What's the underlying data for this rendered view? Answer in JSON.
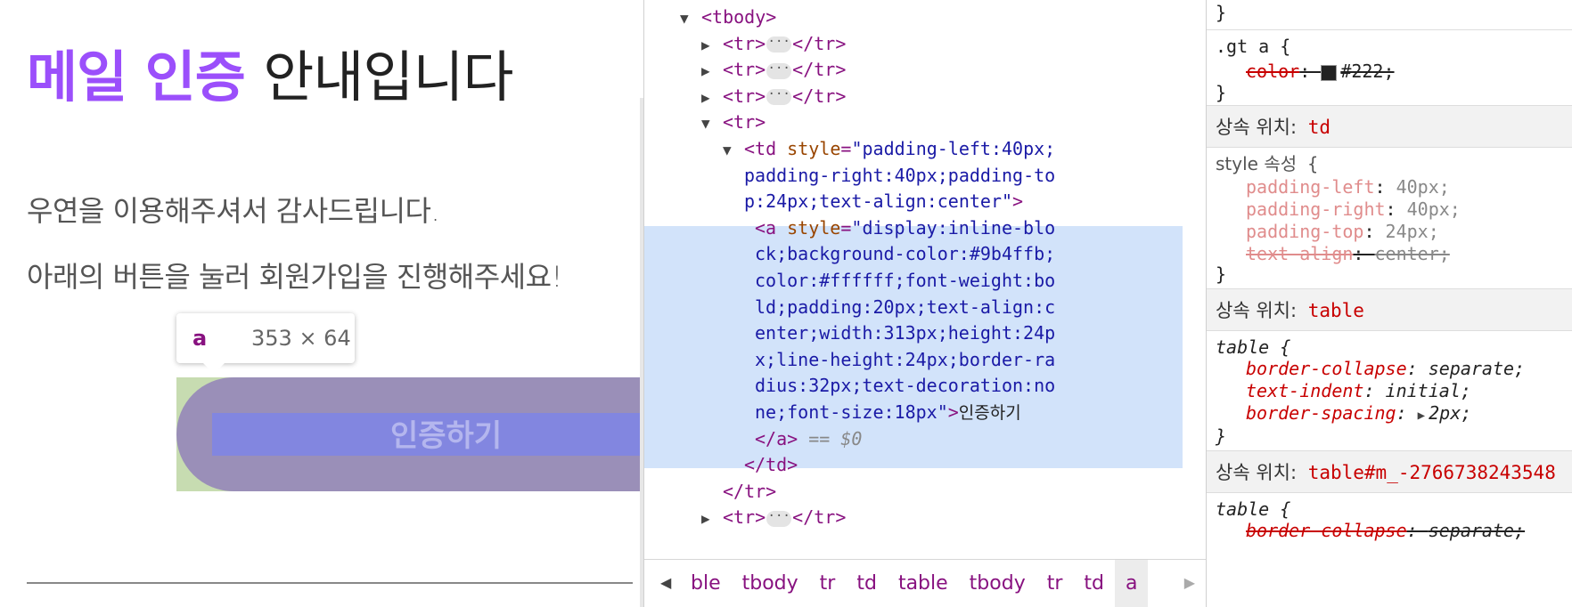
{
  "email": {
    "headline_accent": "메일 인증",
    "headline_rest": "안내입니다",
    "line1": "우연을 이용해주셔서 감사드립니다.",
    "line2": "아래의 버튼을 눌러 회원가입을 진행해주세요!",
    "button_label": "인증하기",
    "accent_color": "#9b4ffb"
  },
  "inspector_tooltip": {
    "tag": "a",
    "size": "353 × 64"
  },
  "elements": {
    "lines": [
      {
        "type": "open",
        "tag": "tbody",
        "expanded": true
      },
      {
        "type": "collapsed",
        "tag": "tr"
      },
      {
        "type": "collapsed",
        "tag": "tr"
      },
      {
        "type": "collapsed",
        "tag": "tr"
      },
      {
        "type": "open",
        "tag": "tr",
        "expanded": true
      },
      {
        "type": "td_open",
        "tag": "td",
        "attr": "style",
        "value_lines": [
          "padding-left:40px;",
          "padding-right:40px;padding-to",
          "p:24px;text-align:center"
        ]
      },
      {
        "type": "a_selected",
        "tag": "a",
        "attr": "style",
        "value_lines": [
          "display:inline-blo",
          "ck;background-color:#9b4ffb;",
          "color:#ffffff;font-weight:bo",
          "ld;padding:20px;text-align:c",
          "enter;width:313px;height:24p",
          "x;line-height:24px;border-ra",
          "dius:32px;text-decoration:no",
          "ne;font-size:18px"
        ],
        "text": "인증하기",
        "marker": "== $0"
      },
      {
        "type": "close",
        "tag": "td"
      },
      {
        "type": "close",
        "tag": "tr"
      },
      {
        "type": "collapsed",
        "tag": "tr"
      }
    ],
    "breadcrumbs": [
      "ble",
      "tbody",
      "tr",
      "td",
      "table",
      "tbody",
      "tr",
      "td",
      "a"
    ],
    "active_crumb": "a"
  },
  "styles": {
    "top_brace": "}",
    "gt_rule": {
      "selector": ".gt a",
      "prop": "color",
      "value": "#222;"
    },
    "inherited_td": {
      "label": "상속 위치:",
      "element": "td"
    },
    "style_attr": {
      "selector": "style 속성",
      "props": [
        {
          "name": "padding-left",
          "value": "40px;"
        },
        {
          "name": "padding-right",
          "value": "40px;"
        },
        {
          "name": "padding-top",
          "value": "24px;"
        },
        {
          "name": "text-align",
          "value": "center;"
        }
      ]
    },
    "inherited_table": {
      "label": "상속 위치:",
      "element": "table"
    },
    "table_rule": {
      "selector": "table",
      "props": [
        {
          "name": "border-collapse",
          "value": "separate;"
        },
        {
          "name": "text-indent",
          "value": "initial;"
        },
        {
          "name": "border-spacing",
          "value": "2px;"
        }
      ]
    },
    "inherited_table_id": {
      "label": "상속 위치:",
      "element": "table#m_-2766738243548"
    },
    "table_rule2": {
      "selector": "table",
      "props": [
        {
          "name": "border-collapse",
          "value": "separate;"
        }
      ]
    }
  }
}
